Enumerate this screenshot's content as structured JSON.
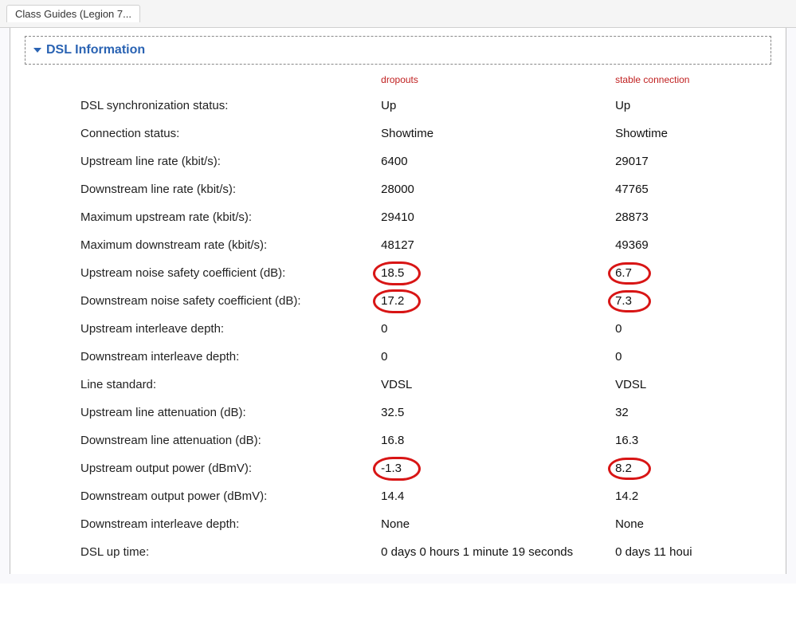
{
  "tab": {
    "title": "Class Guides (Legion 7..."
  },
  "section": {
    "title": "DSL Information"
  },
  "headers": {
    "col1": "dropouts",
    "col2": "stable connection"
  },
  "rows": [
    {
      "label": "DSL synchronization status:",
      "v1": "Up",
      "v2": "Up",
      "c1": false,
      "c2": false
    },
    {
      "label": "Connection status:",
      "v1": "Showtime",
      "v2": "Showtime",
      "c1": false,
      "c2": false
    },
    {
      "label": "Upstream line rate (kbit/s):",
      "v1": "6400",
      "v2": "29017",
      "c1": false,
      "c2": false
    },
    {
      "label": "Downstream line rate (kbit/s):",
      "v1": "28000",
      "v2": "47765",
      "c1": false,
      "c2": false
    },
    {
      "label": "Maximum upstream rate (kbit/s):",
      "v1": "29410",
      "v2": "28873",
      "c1": false,
      "c2": false
    },
    {
      "label": "Maximum downstream rate (kbit/s):",
      "v1": "48127",
      "v2": "49369",
      "c1": false,
      "c2": false
    },
    {
      "label": "Upstream noise safety coefficient (dB):",
      "v1": "18.5",
      "v2": "6.7",
      "c1": true,
      "c2": true
    },
    {
      "label": "Downstream noise safety coefficient (dB):",
      "v1": "17.2",
      "v2": "7.3",
      "c1": true,
      "c2": true
    },
    {
      "label": "Upstream interleave depth:",
      "v1": "0",
      "v2": "0",
      "c1": false,
      "c2": false
    },
    {
      "label": "Downstream interleave depth:",
      "v1": "0",
      "v2": "0",
      "c1": false,
      "c2": false
    },
    {
      "label": "Line standard:",
      "v1": "VDSL",
      "v2": "VDSL",
      "c1": false,
      "c2": false
    },
    {
      "label": "Upstream line attenuation (dB):",
      "v1": "32.5",
      "v2": "32",
      "c1": false,
      "c2": false
    },
    {
      "label": "Downstream line attenuation (dB):",
      "v1": "16.8",
      "v2": "16.3",
      "c1": false,
      "c2": false
    },
    {
      "label": "Upstream output power (dBmV):",
      "v1": "-1.3",
      "v2": "8.2",
      "c1": true,
      "c2": true
    },
    {
      "label": "Downstream output power (dBmV):",
      "v1": "14.4",
      "v2": "14.2",
      "c1": false,
      "c2": false
    },
    {
      "label": "Downstream interleave depth:",
      "v1": "None",
      "v2": "None",
      "c1": false,
      "c2": false
    },
    {
      "label": "DSL up time:",
      "v1": "0 days 0 hours 1 minute 19 seconds",
      "v2": "0 days 11 houi",
      "c1": false,
      "c2": false
    }
  ]
}
